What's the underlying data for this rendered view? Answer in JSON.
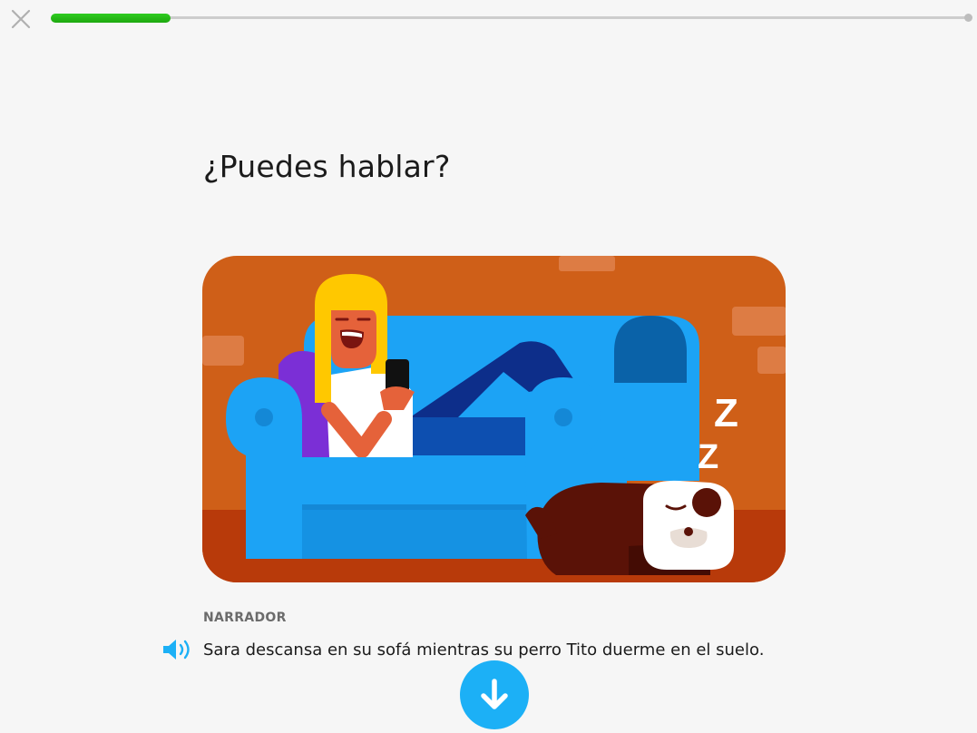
{
  "lesson": {
    "progress_fraction": 0.13
  },
  "colors": {
    "progress": "#2ecc20",
    "accent": "#1cb0f6",
    "wall": "#cf5f18",
    "floor": "#b83a0a",
    "sofa": "#1ca3f5"
  },
  "header": {
    "close_icon": "close-icon"
  },
  "content": {
    "title": "¿Puedes hablar?",
    "speaker": "NARRADOR",
    "line": "Sara descansa en su sofá mientras su perro Tito duerme en el suelo.",
    "audio_icon": "speaker-icon",
    "continue_icon": "arrow-down-icon"
  }
}
